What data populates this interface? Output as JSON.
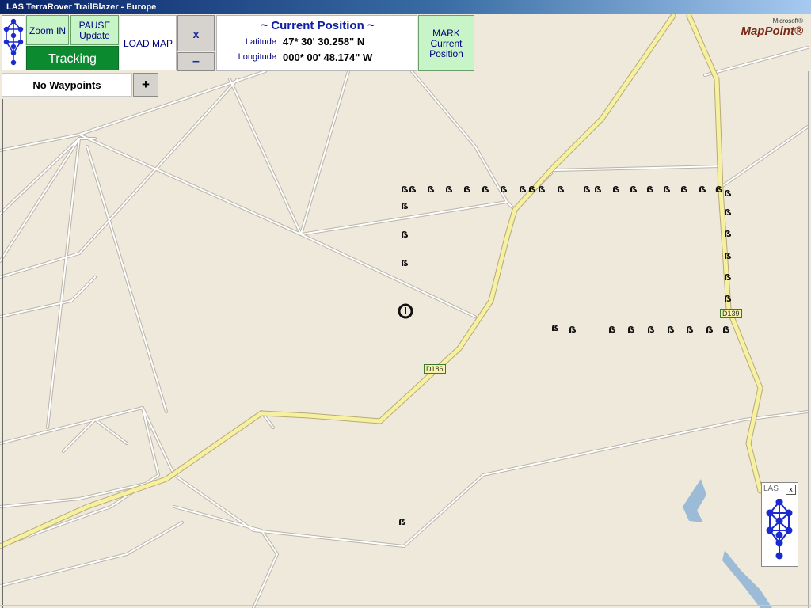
{
  "window": {
    "title": "LAS TerraRover TrailBlazer - Europe"
  },
  "toolbar": {
    "zoom_in": "Zoom IN",
    "pause_update_line1": "PAUSE",
    "pause_update_line2": "Update",
    "tracking": "Tracking",
    "load_map": "LOAD MAP",
    "close": "x",
    "minimize": "–",
    "mark_line1": "MARK",
    "mark_line2": "Current",
    "mark_line3": "Position"
  },
  "position": {
    "title": "~ Current Position ~",
    "latitude_label": "Latitude",
    "latitude_value": "47* 30' 30.258\" N",
    "longitude_label": "Longitude",
    "longitude_value": "000* 00' 48.174\" W"
  },
  "waypoints": {
    "label": "No Waypoints",
    "add": "+"
  },
  "map": {
    "brand_small": "Microsoft®",
    "brand": "MapPoint®",
    "road_labels": [
      "D186",
      "D139"
    ]
  },
  "widget": {
    "label": "LAS",
    "close": "x"
  },
  "colors": {
    "map_bg": "#efe9dc",
    "road_major": "#f6f1a0",
    "road_minor": "#ffffff",
    "water": "#9bbbd6",
    "tracking": "#0c8a2f",
    "button_green": "#c8f5c8"
  }
}
